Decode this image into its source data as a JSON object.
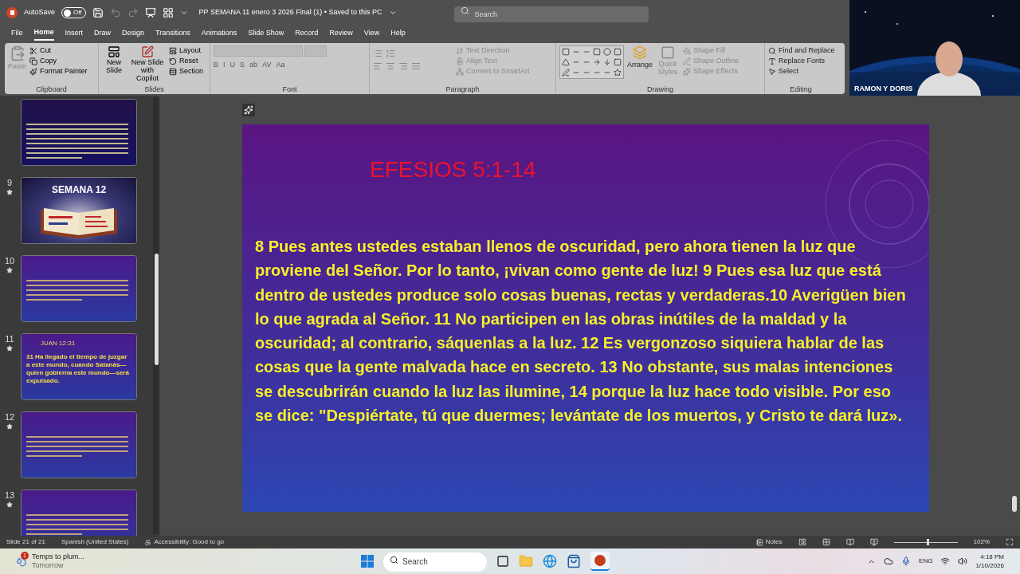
{
  "title_bar": {
    "autosave_label": "AutoSave",
    "autosave": {
      "on": false,
      "label": "Off"
    },
    "document_title": "PP SEMANA 11 enero 3 2026 Final (1) • Saved to this PC",
    "search_placeholder": "Search"
  },
  "menu_tabs": [
    {
      "label": "File",
      "selected": false
    },
    {
      "label": "Home",
      "selected": true
    },
    {
      "label": "Insert",
      "selected": false
    },
    {
      "label": "Draw",
      "selected": false
    },
    {
      "label": "Design",
      "selected": false
    },
    {
      "label": "Transitions",
      "selected": false
    },
    {
      "label": "Animations",
      "selected": false
    },
    {
      "label": "Slide Show",
      "selected": false
    },
    {
      "label": "Record",
      "selected": false
    },
    {
      "label": "Review",
      "selected": false
    },
    {
      "label": "View",
      "selected": false
    },
    {
      "label": "Help",
      "selected": false
    }
  ],
  "ribbon": {
    "clipboard": {
      "label": "Clipboard",
      "paste": {
        "label": "Paste",
        "disabled": true
      },
      "cut": "Cut",
      "copy": "Copy",
      "format_painter": "Format Painter"
    },
    "slides": {
      "label": "Slides",
      "new_slide": "New Slide",
      "new_slide_copilot": "New Slide with Copilot",
      "layout": "Layout",
      "reset": "Reset",
      "section": "Section"
    },
    "font": {
      "label": "Font",
      "buttons": [
        "B",
        "I",
        "U",
        "S",
        "ab",
        "AV",
        "Aa"
      ]
    },
    "paragraph": {
      "label": "Paragraph",
      "items": [
        {
          "label": "Text Direction",
          "disabled": true
        },
        {
          "label": "Align Text",
          "disabled": true
        },
        {
          "label": "Convert to SmartArt",
          "disabled": true
        }
      ]
    },
    "drawing": {
      "label": "Drawing",
      "arrange": "Arrange",
      "quick_styles": {
        "label": "Quick Styles",
        "disabled": true
      },
      "items": [
        {
          "label": "Shape Fill",
          "disabled": true
        },
        {
          "label": "Shape Outline",
          "disabled": true
        },
        {
          "label": "Shape Effects",
          "disabled": true
        }
      ]
    },
    "editing": {
      "label": "Editing",
      "items": [
        "Find and Replace",
        "Replace Fonts",
        "Select"
      ]
    }
  },
  "camera": {
    "name": "RAMON Y DORIS"
  },
  "thumbnails": [
    {
      "kind": "text",
      "selected": false
    },
    {
      "number": "9",
      "kind": "cover",
      "title": "SEMANA 12",
      "selected": false
    },
    {
      "number": "10",
      "kind": "text",
      "selected": false
    },
    {
      "number": "11",
      "kind": "verse",
      "title": "JUAN 12:31",
      "body": "31 Ha llegado el tiempo de juzgar a este mundo, cuando Satanás—quien gobierna este mundo—será expulsado.",
      "selected": false
    },
    {
      "number": "12",
      "kind": "text",
      "selected": false
    },
    {
      "number": "13",
      "kind": "text",
      "selected": false
    }
  ],
  "slide": {
    "title": "EFESIOS 5:1-14",
    "body": " 8 Pues antes ustedes estaban llenos de oscuridad, pero ahora tienen la luz que proviene del Señor. Por lo tanto, ¡vivan como gente de luz! 9 Pues esa luz que está dentro de ustedes produce solo cosas buenas, rectas y verdaderas.10 Averigüen bien lo que agrada al Señor. 11 No participen en las obras inútiles de la maldad y la oscuridad; al contrario, sáquenlas a la luz. 12 Es vergonzoso siquiera hablar de las cosas que la gente malvada hace en secreto. 13 No obstante, sus malas intenciones se descubrirán cuando la luz las ilumine, 14 porque la luz hace todo visible. Por eso se dice: \"Despiértate, tú que duermes; levántate de los muertos, y Cristo te dará luz»."
  },
  "status_bar": {
    "slide_count": "Slide 21 of 21",
    "language": "Spanish (United States)",
    "accessibility": "Accessibility: Good to go",
    "notes": "Notes",
    "zoom": "102%",
    "zoom_slider": {
      "level": 0.52
    }
  },
  "taskbar": {
    "weather": {
      "title": "Temps to plum...",
      "subtitle": "Tomorrow",
      "badge": "1"
    },
    "search_placeholder": "Search",
    "language": "ENG",
    "time": "4:18 PM",
    "date": "1/10/2026"
  }
}
